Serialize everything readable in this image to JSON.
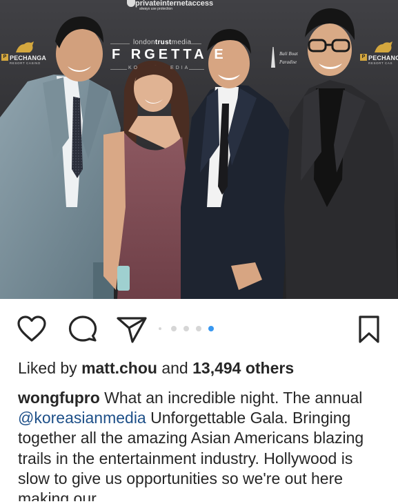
{
  "photo": {
    "sponsor": "privateinternetaccess",
    "sponsor_tagline": "always use protection",
    "media_prefix": "london",
    "media_brand": "trust",
    "media_suffix": "media",
    "gala_title": "F RGETTA E",
    "gala_sub_left": "KO",
    "gala_sub_right": "EDIA",
    "resort_name": "PECHANGA",
    "resort_sub": "RESORT CASINO",
    "resort_name_right": "PECHANG",
    "resort_sub_right": "RESORT CAS",
    "bali_line1": "Bali Boat",
    "bali_line2": "Paradise",
    "colors": {
      "backdrop": "#2e2e31",
      "logo_gold": "#d4a73e"
    }
  },
  "actions": {
    "like_icon": "heart-outline-icon",
    "comment_icon": "comment-bubble-icon",
    "share_icon": "paper-plane-icon",
    "save_icon": "bookmark-outline-icon",
    "carousel": {
      "count": 5,
      "active_index": 4,
      "active_color": "#3897f0"
    }
  },
  "likes": {
    "prefix": "Liked by ",
    "user": "matt.chou",
    "middle": " and ",
    "count": "13,494 others"
  },
  "caption": {
    "author": "wongfupro",
    "text_1": " What an incredible night. The annual ",
    "mention": "@koreasianmedia",
    "text_2": " Unforgettable Gala. Bringing together all the amazing Asian Americans blazing trails in the entertainment industry. Hollywood is slow to give us opportunities so we're out here making our"
  }
}
